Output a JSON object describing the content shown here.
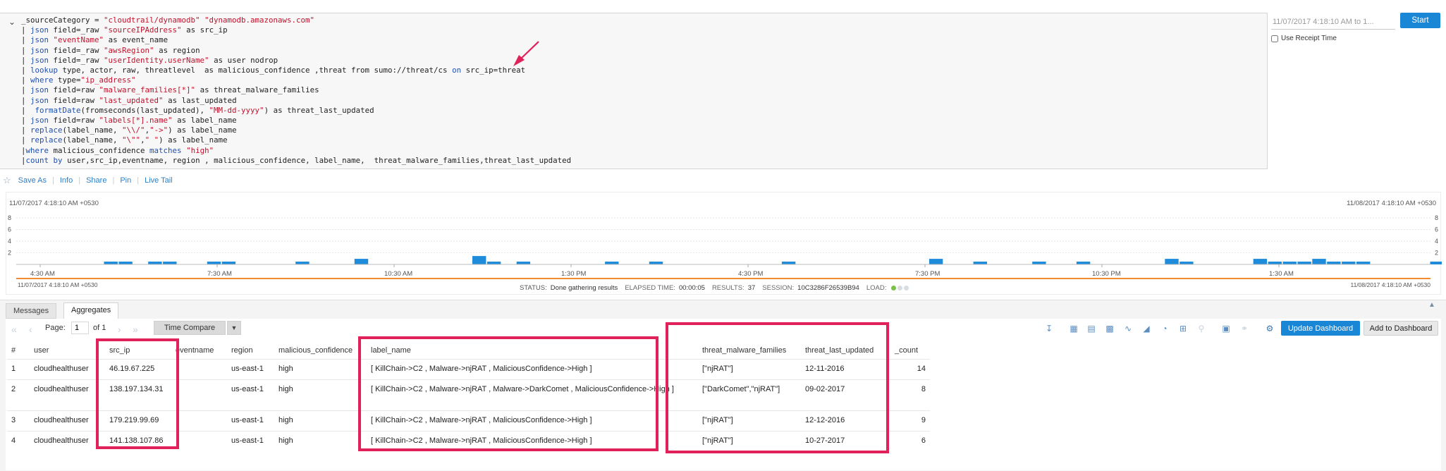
{
  "query": {
    "lines": [
      [
        {
          "t": "_sourceCategory = "
        },
        {
          "t": "\"cloudtrail/dynamodb\"",
          "c": "st"
        },
        {
          "t": " "
        },
        {
          "t": "\"dynamodb.amazonaws.com\"",
          "c": "st"
        }
      ],
      [
        {
          "t": "| "
        },
        {
          "t": "json",
          "c": "kw"
        },
        {
          "t": " field=_raw "
        },
        {
          "t": "\"sourceIPAddress\"",
          "c": "st"
        },
        {
          "t": " as src_ip"
        }
      ],
      [
        {
          "t": "| "
        },
        {
          "t": "json",
          "c": "kw"
        },
        {
          "t": " "
        },
        {
          "t": "\"eventName\"",
          "c": "st"
        },
        {
          "t": " as event_name"
        }
      ],
      [
        {
          "t": "| "
        },
        {
          "t": "json",
          "c": "kw"
        },
        {
          "t": " field=_raw "
        },
        {
          "t": "\"awsRegion\"",
          "c": "st"
        },
        {
          "t": " as region"
        }
      ],
      [
        {
          "t": "| "
        },
        {
          "t": "json",
          "c": "kw"
        },
        {
          "t": " field=_raw "
        },
        {
          "t": "\"userIdentity.userName\"",
          "c": "st"
        },
        {
          "t": " as user nodrop"
        }
      ],
      [
        {
          "t": "| "
        },
        {
          "t": "lookup",
          "c": "kw"
        },
        {
          "t": " type, actor, raw, threatlevel  as malicious_confidence ,threat from sumo://threat/cs "
        },
        {
          "t": "on",
          "c": "kw"
        },
        {
          "t": " src_ip=threat"
        }
      ],
      [
        {
          "t": "| "
        },
        {
          "t": "where",
          "c": "kw"
        },
        {
          "t": " type="
        },
        {
          "t": "\"ip_address\"",
          "c": "st"
        }
      ],
      [
        {
          "t": "| "
        },
        {
          "t": "json",
          "c": "kw"
        },
        {
          "t": " field=raw "
        },
        {
          "t": "\"malware_families[*]\"",
          "c": "st"
        },
        {
          "t": " as threat_malware_families"
        }
      ],
      [
        {
          "t": "| "
        },
        {
          "t": "json",
          "c": "kw"
        },
        {
          "t": " field=raw "
        },
        {
          "t": "\"last_updated\"",
          "c": "st"
        },
        {
          "t": " as last_updated"
        }
      ],
      [
        {
          "t": "|  "
        },
        {
          "t": "formatDate",
          "c": "kw"
        },
        {
          "t": "(fromseconds(last_updated), "
        },
        {
          "t": "\"MM-dd-yyyy\"",
          "c": "st"
        },
        {
          "t": ") as threat_last_updated"
        }
      ],
      [
        {
          "t": "| "
        },
        {
          "t": "json",
          "c": "kw"
        },
        {
          "t": " field=raw "
        },
        {
          "t": "\"labels[*].name\"",
          "c": "st"
        },
        {
          "t": " as label_name"
        }
      ],
      [
        {
          "t": "| "
        },
        {
          "t": "replace",
          "c": "kw"
        },
        {
          "t": "(label_name, "
        },
        {
          "t": "\"\\\\/\"",
          "c": "st"
        },
        {
          "t": ","
        },
        {
          "t": "\"->\"",
          "c": "st"
        },
        {
          "t": ") as label_name"
        }
      ],
      [
        {
          "t": "| "
        },
        {
          "t": "replace",
          "c": "kw"
        },
        {
          "t": "(label_name, "
        },
        {
          "t": "\"\\\"\"",
          "c": "st"
        },
        {
          "t": ","
        },
        {
          "t": "\" \"",
          "c": "st"
        },
        {
          "t": ") as label_name"
        }
      ],
      [
        {
          "t": "|"
        },
        {
          "t": "where",
          "c": "kw"
        },
        {
          "t": " malicious_confidence "
        },
        {
          "t": "matches",
          "c": "kw"
        },
        {
          "t": " "
        },
        {
          "t": "\"high\"",
          "c": "st"
        }
      ],
      [
        {
          "t": "|"
        },
        {
          "t": "count",
          "c": "kw"
        },
        {
          "t": " "
        },
        {
          "t": "by",
          "c": "kw"
        },
        {
          "t": " user,src_ip,eventname, region , malicious_confidence, label_name,  threat_malware_families,threat_last_updated"
        }
      ]
    ]
  },
  "controls": {
    "time_range": "11/07/2017 4:18:10 AM to 1...",
    "start_label": "Start",
    "use_receipt_time": "Use Receipt Time"
  },
  "actions": {
    "save_as": "Save As",
    "info": "Info",
    "share": "Share",
    "pin": "Pin",
    "live_tail": "Live Tail"
  },
  "histogram": {
    "start_time": "11/07/2017 4:18:10 AM +0530",
    "end_time": "11/08/2017 4:18:10 AM +0530",
    "bottom_start": "11/07/2017 4:18:10 AM +0530",
    "bottom_end": "11/08/2017 4:18:10 AM +0530",
    "y_ticks": [
      "8",
      "6",
      "4",
      "2"
    ],
    "y_max": 8,
    "x_labels": [
      "4:30 AM",
      "7:30 AM",
      "10:30 AM",
      "1:30 PM",
      "4:30 PM",
      "7:30 PM",
      "10:30 PM",
      "1:30 AM"
    ],
    "bar_color": "#1e8bdb",
    "bars": [
      {
        "slot": 5,
        "v": 1
      },
      {
        "slot": 6,
        "v": 1
      },
      {
        "slot": 8,
        "v": 1
      },
      {
        "slot": 9,
        "v": 1
      },
      {
        "slot": 12,
        "v": 1
      },
      {
        "slot": 13,
        "v": 1
      },
      {
        "slot": 18,
        "v": 1
      },
      {
        "slot": 22,
        "v": 2
      },
      {
        "slot": 30,
        "v": 3
      },
      {
        "slot": 31,
        "v": 1
      },
      {
        "slot": 33,
        "v": 1
      },
      {
        "slot": 39,
        "v": 1
      },
      {
        "slot": 42,
        "v": 1
      },
      {
        "slot": 51,
        "v": 1
      },
      {
        "slot": 61,
        "v": 2
      },
      {
        "slot": 64,
        "v": 1
      },
      {
        "slot": 68,
        "v": 1
      },
      {
        "slot": 71,
        "v": 1
      },
      {
        "slot": 77,
        "v": 2
      },
      {
        "slot": 78,
        "v": 1
      },
      {
        "slot": 83,
        "v": 2
      },
      {
        "slot": 84,
        "v": 1
      },
      {
        "slot": 85,
        "v": 1
      },
      {
        "slot": 86,
        "v": 1
      },
      {
        "slot": 87,
        "v": 2
      },
      {
        "slot": 88,
        "v": 1
      },
      {
        "slot": 89,
        "v": 1
      },
      {
        "slot": 90,
        "v": 1
      },
      {
        "slot": 95,
        "v": 1
      }
    ],
    "status_label": "STATUS:",
    "status": "Done gathering results",
    "elapsed_label": "ELAPSED TIME:",
    "elapsed": "00:00:05",
    "results_label": "RESULTS:",
    "results": "37",
    "session_label": "SESSION:",
    "session": "10C3286F26539B94",
    "load_label": "LOAD:"
  },
  "results": {
    "tabs": [
      "Messages",
      "Aggregates"
    ],
    "page_label": "Page:",
    "page": "1",
    "of_label": "of 1",
    "time_compare": "Time Compare",
    "update_dashboard": "Update Dashboard",
    "add_to_dashboard": "Add to Dashboard",
    "columns": [
      "#",
      "user",
      "src_ip",
      "eventname",
      "region",
      "malicious_confidence",
      "label_name",
      "threat_malware_families",
      "threat_last_updated",
      "_count"
    ],
    "rows": [
      [
        "1",
        "cloudhealthuser",
        "46.19.67.225",
        "",
        "us-east-1",
        "high",
        "[ KillChain->C2 , Malware->njRAT , MaliciousConfidence->High ]",
        "[\"njRAT\"]",
        "12-11-2016",
        "14"
      ],
      [
        "2",
        "cloudhealthuser",
        "138.197.134.31",
        "",
        "us-east-1",
        "high",
        "[ KillChain->C2 , Malware->njRAT , Malware->DarkComet , MaliciousConfidence->High ]",
        "[\"DarkComet\",\"njRAT\"]",
        "09-02-2017",
        "8"
      ],
      [
        "3",
        "cloudhealthuser",
        "179.219.99.69",
        "",
        "us-east-1",
        "high",
        "[ KillChain->C2 , Malware->njRAT , MaliciousConfidence->High ]",
        "[\"njRAT\"]",
        "12-12-2016",
        "9"
      ],
      [
        "4",
        "cloudhealthuser",
        "141.138.107.86",
        "",
        "us-east-1",
        "high",
        "[ KillChain->C2 , Malware->njRAT , MaliciousConfidence->High ]",
        "[\"njRAT\"]",
        "10-27-2017",
        "6"
      ]
    ]
  },
  "colors": {
    "accent": "#1a87d6",
    "highlight": "#e1225a",
    "timeline": "#f28a30"
  }
}
